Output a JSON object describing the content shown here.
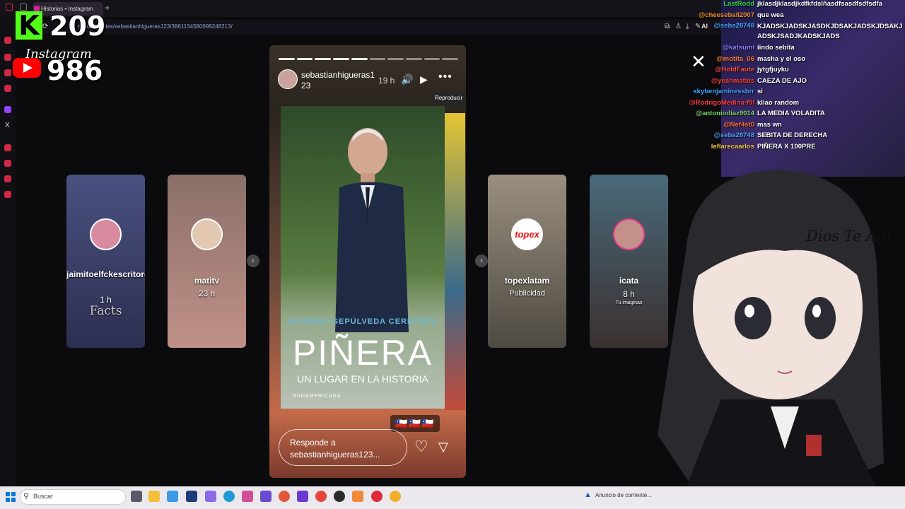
{
  "browser": {
    "tab_title": "Historias • Instagram",
    "new_tab": "+",
    "url": "m.com/stories/sebastianhigueras123/3861134580699248213/",
    "ai_label": "AI"
  },
  "overlay": {
    "kick_count": "209",
    "instagram_label": "Instagram",
    "youtube_count": "986"
  },
  "side_cards": [
    {
      "name": "jaimitoelfckescritoroficial",
      "time": "1 h",
      "extra": "Facts",
      "bg": "#3a3f66"
    },
    {
      "name": "matitv",
      "time": "23 h",
      "extra": "",
      "bg": "#b48880"
    },
    {
      "name": "topexlatam",
      "time": "Publicidad",
      "extra": "",
      "bg": "#6b6458"
    },
    {
      "name": "icata",
      "time": "8 h",
      "extra": "Tu imaginas",
      "bg": "#5a4c48"
    }
  ],
  "topex_logo": "topex",
  "story": {
    "username": "sebastianhigueras123",
    "time": "19 h",
    "tooltip": "Reproducir",
    "author": "ALFREDO SEPÚLVEDA CERECEDA",
    "title": "PIÑERA",
    "subtitle": "UN LUGAR EN LA HISTORIA",
    "publisher": "SUDAMERICANA",
    "flags": "🇨🇱🇨🇱🇨🇱",
    "reply_placeholder": "Responde a sebastianhigueras123...",
    "progress_segments": 10,
    "progress_done": 5
  },
  "chat": [
    {
      "user": "LastRodd",
      "msg": "jklasdjklasdjkdfkfdslñasdfsasdfsdfsdfa",
      "color": "#3bd33b"
    },
    {
      "user": "@cheeseball2007",
      "msg": "que wea",
      "color": "#f28c28"
    },
    {
      "user": "@seba28748",
      "msg": "KJADSKJADSKJASDKJDSAKJADSKJDSAKJADSKJSADJKADSKJADS",
      "color": "#4aa3ff"
    },
    {
      "user": "@katsumi",
      "msg": "iindo sebita",
      "color": "#8a7cff"
    },
    {
      "user": "@motita_06",
      "msg": "masha y el oso",
      "color": "#ff7a3a"
    },
    {
      "user": "@HoldFaute",
      "msg": "jytgfjuyku",
      "color": "#ff4d4d"
    },
    {
      "user": "@yeahmatias",
      "msg": "CAEZA DE AJO",
      "color": "#ff3a3a"
    },
    {
      "user": "skybenjaminessbrr",
      "msg": "si",
      "color": "#3aa6ff"
    },
    {
      "user": "@RodrigoMedina-f9l",
      "msg": "kliao random",
      "color": "#ff3a3a"
    },
    {
      "user": "@antoniodiaz9014",
      "msg": "LA MEDIA VOLADITA",
      "color": "#7bd36b"
    },
    {
      "user": "@Nef4st0",
      "msg": "mas wn",
      "color": "#ff6a3a"
    },
    {
      "user": "@seba28748",
      "msg": "SEBITA DE DERECHA",
      "color": "#4aa3ff"
    },
    {
      "user": "leflarecaarlos",
      "msg": "PIÑERA X 100PRE",
      "color": "#f5c542"
    }
  ],
  "vtuber_text": "Dios Te Am",
  "taskbar": {
    "search_label": "Buscar",
    "notice": "Anuncio de corriente..."
  },
  "icons": {
    "search": "search-icon",
    "windows": "windows-icon",
    "close": "close-icon",
    "heart": "heart-icon",
    "share": "share-icon",
    "play": "play-icon",
    "volume": "volume-icon",
    "more": "more-icon",
    "warning": "warning-icon"
  }
}
